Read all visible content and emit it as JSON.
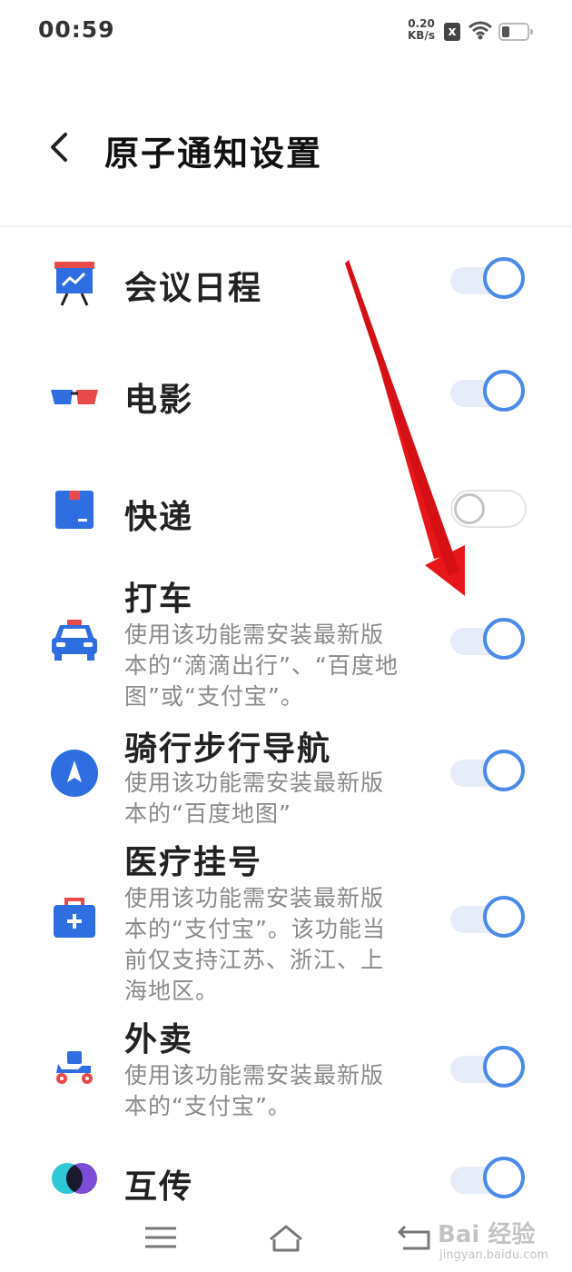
{
  "status_bar": {
    "time": "00:59",
    "net_speed_value": "0.20",
    "net_speed_unit": "KB/s",
    "sim_icon": "x"
  },
  "header": {
    "title": "原子通知设置"
  },
  "items": [
    {
      "title": "会议日程",
      "desc": "",
      "enabled": true
    },
    {
      "title": "电影",
      "desc": "",
      "enabled": true
    },
    {
      "title": "快递",
      "desc": "",
      "enabled": false
    },
    {
      "title": "打车",
      "desc": "使用该功能需安装最新版本的“滴滴出行”、“百度地图”或“支付宝”。",
      "enabled": true
    },
    {
      "title": "骑行步行导航",
      "desc": "使用该功能需安装最新版本的“百度地图”",
      "enabled": true
    },
    {
      "title": "医疗挂号",
      "desc": "使用该功能需安装最新版本的“支付宝”。该功能当前仅支持江苏、浙江、上海地区。",
      "enabled": true
    },
    {
      "title": "外卖",
      "desc": "使用该功能需安装最新版本的“支付宝”。",
      "enabled": true
    },
    {
      "title": "互传",
      "desc": "",
      "enabled": true
    }
  ],
  "watermark": {
    "text": "Bai 经验",
    "url_text": "jingyan.baidu.com"
  },
  "colors": {
    "accent": "#4a8ae8",
    "arrow": "#e8161b"
  }
}
